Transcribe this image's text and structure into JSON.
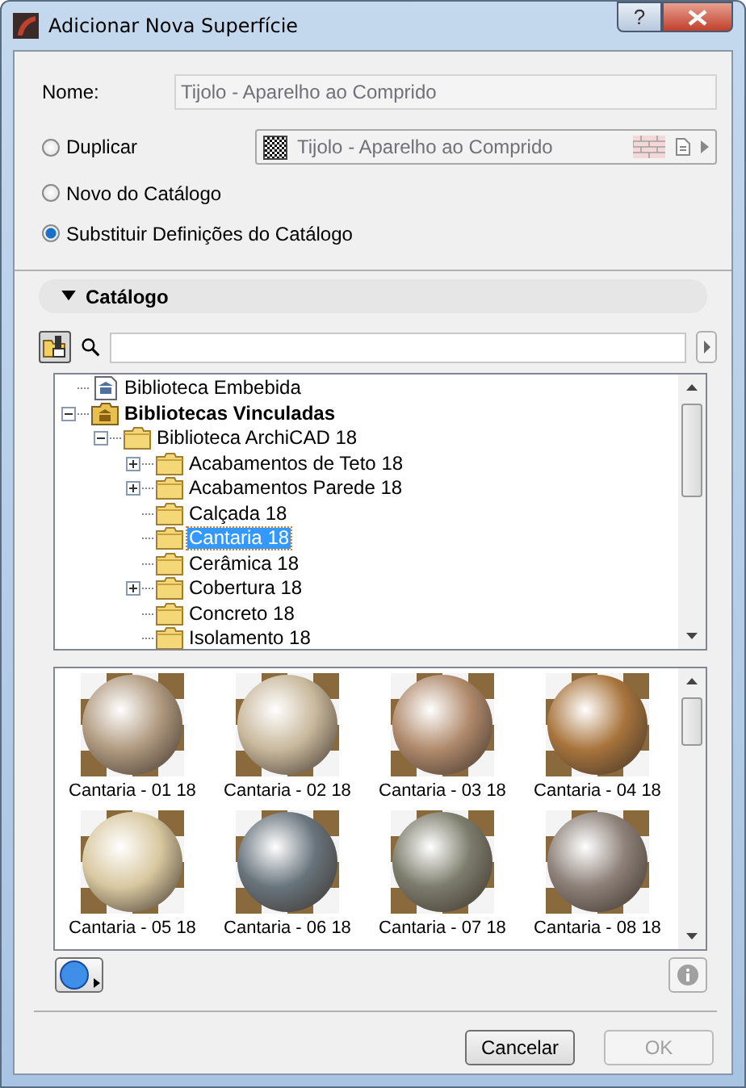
{
  "window": {
    "title": "Adicionar Nova Superfície",
    "help": "?"
  },
  "name_field": {
    "label": "Nome:",
    "value": "Tijolo - Aparelho ao Comprido"
  },
  "options": [
    {
      "label": "Duplicar",
      "selected": false,
      "kind": "duplicate",
      "source": "Tijolo - Aparelho ao Comprido"
    },
    {
      "label": "Novo do Catálogo",
      "selected": false,
      "kind": "plain"
    },
    {
      "label": "Substituir Definições do Catálogo",
      "selected": true,
      "kind": "plain"
    }
  ],
  "catalog": {
    "title": "Catálogo",
    "expanded": true,
    "tree": [
      {
        "label": "Biblioteca Embebida",
        "kind": "embedded-library",
        "expandable": false,
        "selected": false
      },
      {
        "label": "Bibliotecas Vinculadas",
        "kind": "linked-libraries",
        "expandable": true,
        "expanded": true,
        "selected": false,
        "children": [
          {
            "label": "Biblioteca ArchiCAD 18",
            "kind": "folder",
            "expandable": true,
            "expanded": true,
            "selected": false,
            "children": [
              {
                "label": "Acabamentos de Teto 18",
                "kind": "folder",
                "expandable": true,
                "expanded": false,
                "selected": false
              },
              {
                "label": "Acabamentos Parede 18",
                "kind": "folder",
                "expandable": true,
                "expanded": false,
                "selected": false
              },
              {
                "label": "Calçada 18",
                "kind": "folder",
                "expandable": false,
                "selected": false
              },
              {
                "label": "Cantaria 18",
                "kind": "folder",
                "expandable": false,
                "selected": true
              },
              {
                "label": "Cerâmica 18",
                "kind": "folder",
                "expandable": false,
                "selected": false
              },
              {
                "label": "Cobertura 18",
                "kind": "folder",
                "expandable": true,
                "expanded": false,
                "selected": false
              },
              {
                "label": "Concreto 18",
                "kind": "folder",
                "expandable": false,
                "selected": false
              },
              {
                "label": "Isolamento 18",
                "kind": "folder",
                "expandable": false,
                "selected": false
              }
            ]
          }
        ]
      }
    ],
    "surfaces": [
      {
        "label": "Cantaria - 01 18",
        "color": "#b09a80"
      },
      {
        "label": "Cantaria - 02 18",
        "color": "#c8b89c"
      },
      {
        "label": "Cantaria - 03 18",
        "color": "#b08a6c"
      },
      {
        "label": "Cantaria - 04 18",
        "color": "#a8743c"
      },
      {
        "label": "Cantaria - 05 18",
        "color": "#d8c8a0"
      },
      {
        "label": "Cantaria - 06 18",
        "color": "#68747c"
      },
      {
        "label": "Cantaria - 07 18",
        "color": "#7c7c6c"
      },
      {
        "label": "Cantaria - 08 18",
        "color": "#8c8078"
      }
    ]
  },
  "buttons": [
    {
      "label": "Cancelar",
      "disabled": false
    },
    {
      "label": "OK",
      "disabled": true
    }
  ]
}
